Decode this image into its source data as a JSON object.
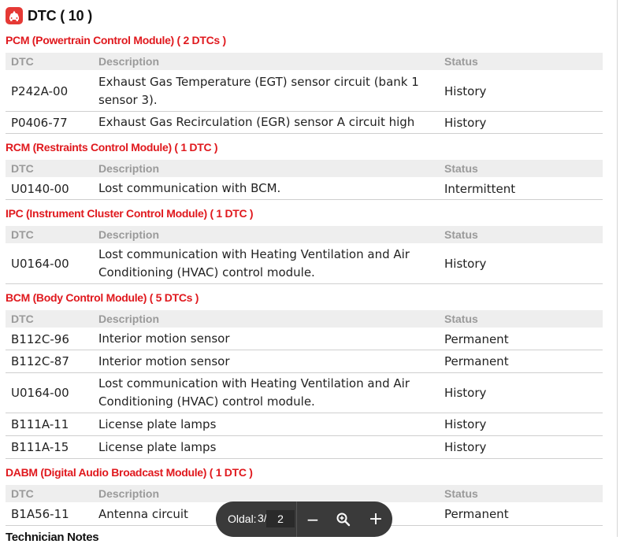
{
  "report": {
    "title": "DTC ( 10 )",
    "columns": {
      "dtc": "DTC",
      "description": "Description",
      "status": "Status"
    },
    "modules": [
      {
        "title": "PCM (Powertrain Control Module) ( 2 DTCs )",
        "rows": [
          {
            "code": "P242A-00",
            "description": "Exhaust Gas Temperature (EGT) sensor circuit (bank 1 sensor 3).",
            "status": "History"
          },
          {
            "code": "P0406-77",
            "description": "Exhaust Gas Recirculation (EGR) sensor A circuit high",
            "status": "History"
          }
        ]
      },
      {
        "title": "RCM (Restraints Control Module) ( 1 DTC )",
        "rows": [
          {
            "code": "U0140-00",
            "description": "Lost communication with BCM.",
            "status": "Intermittent"
          }
        ]
      },
      {
        "title": "IPC (Instrument Cluster Control Module) ( 1 DTC )",
        "rows": [
          {
            "code": "U0164-00",
            "description": "Lost communication with Heating Ventilation and Air Conditioning (HVAC) control module.",
            "status": "History"
          }
        ]
      },
      {
        "title": "BCM (Body Control Module) ( 5 DTCs )",
        "rows": [
          {
            "code": "B112C-96",
            "description": "Interior motion sensor",
            "status": "Permanent"
          },
          {
            "code": "B112C-87",
            "description": "Interior motion sensor",
            "status": "Permanent"
          },
          {
            "code": "U0164-00",
            "description": "Lost communication with Heating Ventilation and Air Conditioning (HVAC) control module.",
            "status": "History"
          },
          {
            "code": "B111A-11",
            "description": "License plate lamps",
            "status": "History"
          },
          {
            "code": "B111A-15",
            "description": "License plate lamps",
            "status": "History"
          }
        ]
      },
      {
        "title": "DABM (Digital Audio Broadcast Module) ( 1 DTC )",
        "rows": [
          {
            "code": "B1A56-11",
            "description": "Antenna circuit",
            "status": "Permanent"
          }
        ]
      }
    ],
    "footer_heading": "Technician Notes"
  },
  "toolbar": {
    "page_label": "Oldal:",
    "page_total": "3/",
    "page_value": "2",
    "zoom_out_label": "−",
    "zoom_in_label": "+"
  },
  "icons": {
    "title_icon": "car-alert-icon",
    "zoom_icon": "magnifier-icon"
  },
  "colors": {
    "accent": "#e0191e",
    "icon_bg": "#e53935",
    "header_bg": "#eeeeee",
    "header_text": "#9a9a9a",
    "toolbar_bg": "#3a3a3a"
  }
}
